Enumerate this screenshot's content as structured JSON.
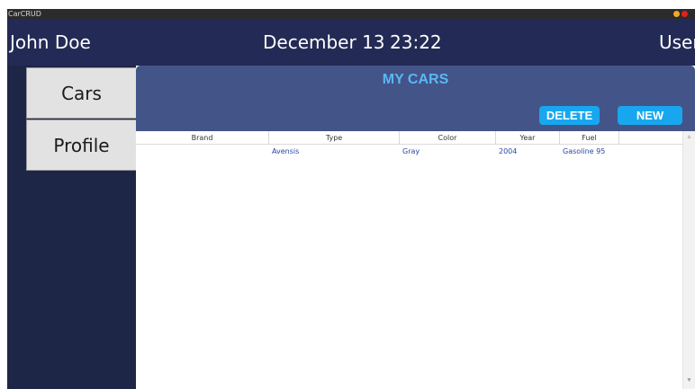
{
  "window": {
    "title": "CarCRUD"
  },
  "header": {
    "user_name": "John Doe",
    "date": "December 13",
    "time": "23:22",
    "user_role": "User"
  },
  "sidebar": {
    "items": [
      {
        "label": "Cars"
      },
      {
        "label": "Profile"
      }
    ]
  },
  "main": {
    "title": "MY CARS",
    "delete_label": "DELETE",
    "new_label": "NEW",
    "table": {
      "columns": [
        "Brand",
        "Type",
        "Color",
        "Year",
        "Fuel",
        ""
      ],
      "rows": [
        {
          "brand": "",
          "type": "Avensis",
          "color": "Gray",
          "year": "2004",
          "fuel": "Gasoline 95"
        }
      ]
    }
  },
  "colors": {
    "header_bg": "#232a55",
    "sidebar_bg": "#1e2647",
    "content_header_bg": "#435488",
    "title_color": "#5ab7f5",
    "button_bg": "#18a7ef",
    "row_text": "#2b46a0"
  },
  "icons": {
    "scroll_up": "▲",
    "scroll_down": "▼"
  }
}
